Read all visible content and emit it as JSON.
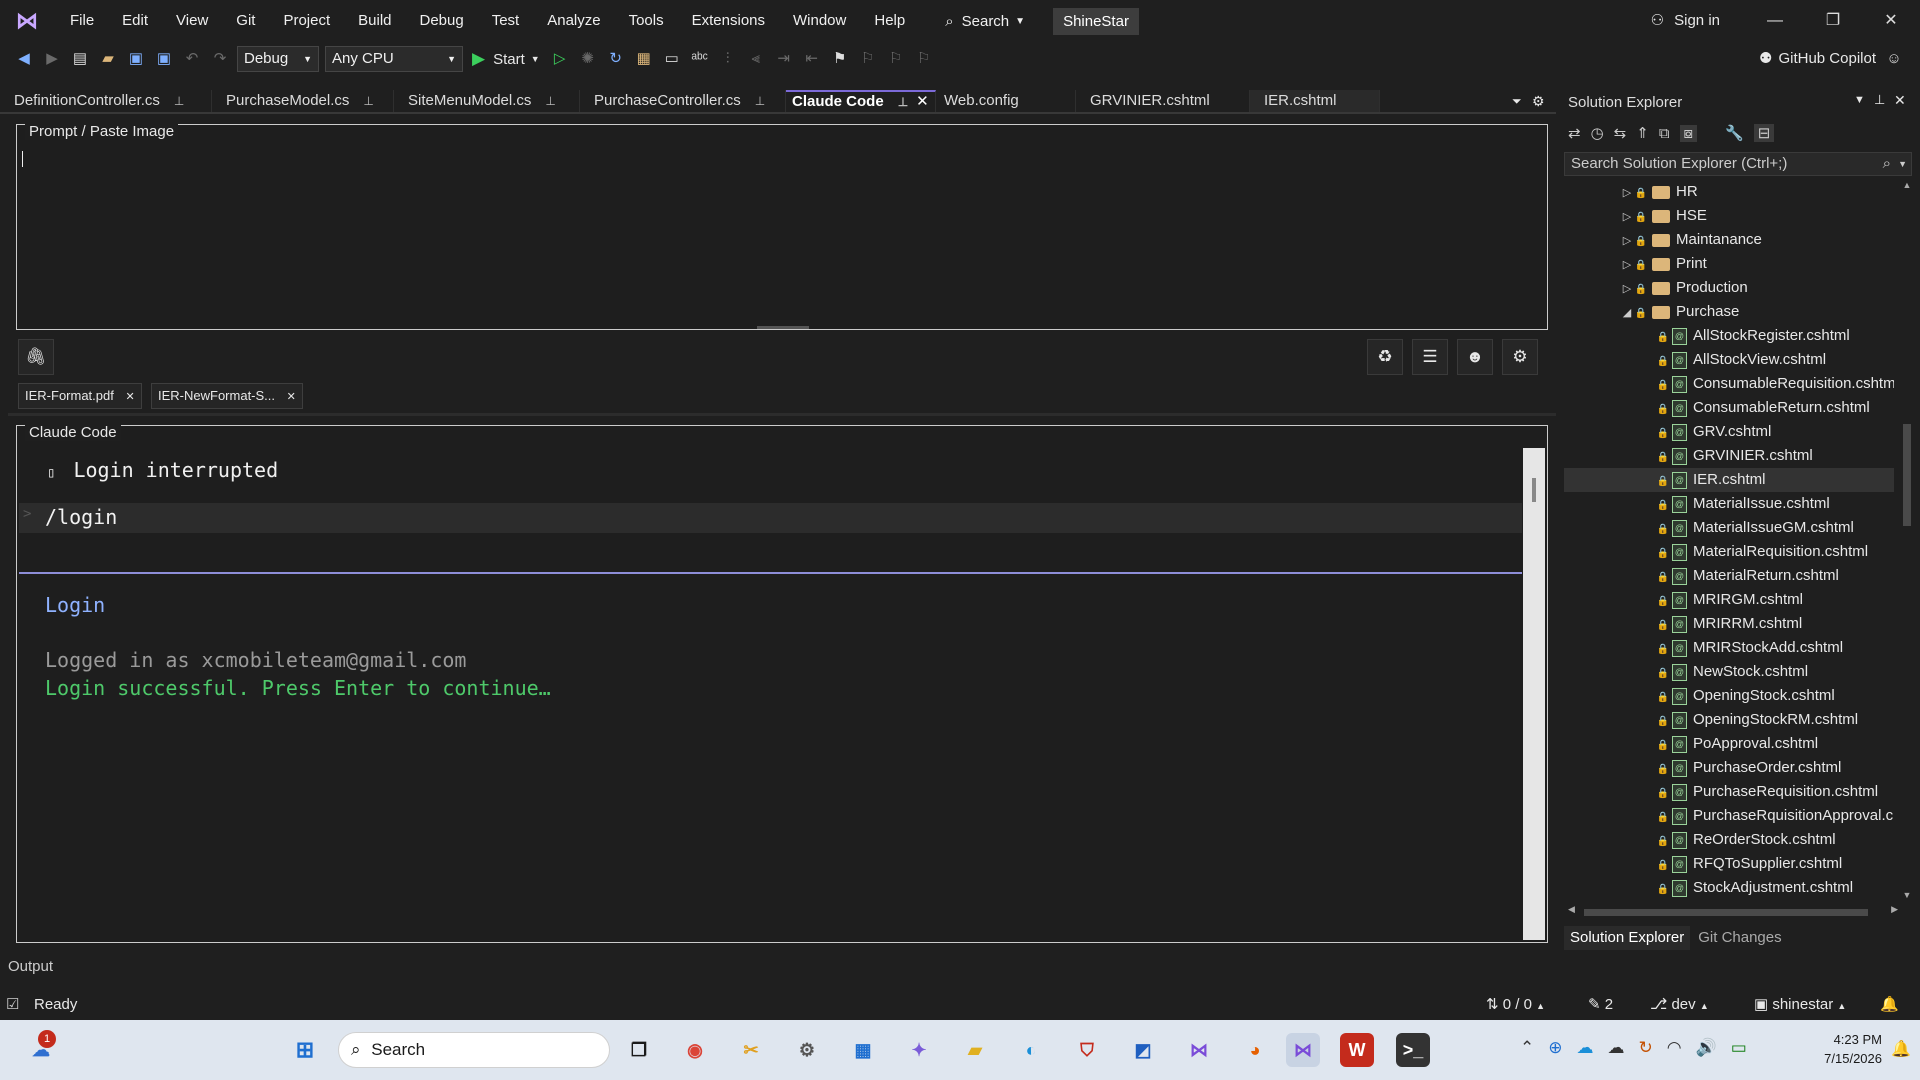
{
  "titlebar": {
    "menu": [
      "File",
      "Edit",
      "View",
      "Git",
      "Project",
      "Build",
      "Debug",
      "Test",
      "Analyze",
      "Tools",
      "Extensions",
      "Window",
      "Help"
    ],
    "search_label": "Search",
    "project_name": "ShineStar",
    "sign_in": "Sign in"
  },
  "toolbar": {
    "config": "Debug",
    "platform": "Any CPU",
    "start_label": "Start",
    "copilot_label": "GitHub Copilot"
  },
  "tabs": [
    {
      "label": "DefinitionController.cs"
    },
    {
      "label": "PurchaseModel.cs"
    },
    {
      "label": "SiteMenuModel.cs"
    },
    {
      "label": "PurchaseController.cs"
    },
    {
      "label": "Claude Code"
    },
    {
      "label": "Web.config"
    },
    {
      "label": "GRVINIER.cshtml"
    },
    {
      "label": "IER.cshtml"
    }
  ],
  "prompt": {
    "legend": "Prompt / Paste Image",
    "attachments": [
      "IER-Format.pdf",
      "IER-NewFormat-S..."
    ]
  },
  "claude_panel": {
    "legend": "Claude Code",
    "interrupt_line": "Login interrupted",
    "command_line": "/login",
    "section_title": "Login",
    "logged_in_text": "Logged in as xcmobileteam@gmail.com",
    "success_text": "Login successful. Press Enter to continue…"
  },
  "solution_explorer": {
    "title": "Solution Explorer",
    "search_placeholder": "Search Solution Explorer (Ctrl+;)",
    "folders": [
      "HR",
      "HSE",
      "Maintanance",
      "Print",
      "Production",
      "Purchase"
    ],
    "files": [
      "AllStockRegister.cshtml",
      "AllStockView.cshtml",
      "ConsumableRequisition.cshtm",
      "ConsumableReturn.cshtml",
      "GRV.cshtml",
      "GRVINIER.cshtml",
      "IER.cshtml",
      "MaterialIssue.cshtml",
      "MaterialIssueGM.cshtml",
      "MaterialRequisition.cshtml",
      "MaterialReturn.cshtml",
      "MRIRGM.cshtml",
      "MRIRRM.cshtml",
      "MRIRStockAdd.cshtml",
      "NewStock.cshtml",
      "OpeningStock.cshtml",
      "OpeningStockRM.cshtml",
      "PoApproval.cshtml",
      "PurchaseOrder.cshtml",
      "PurchaseRequisition.cshtml",
      "PurchaseRquisitionApproval.c",
      "ReOrderStock.cshtml",
      "RFQToSupplier.cshtml",
      "StockAdjustment.cshtml"
    ],
    "bottom_tabs": [
      "Solution Explorer",
      "Git Changes"
    ]
  },
  "output_label": "Output",
  "status": {
    "ready": "Ready",
    "commits": "0 / 0",
    "edits": "2",
    "branch": "dev",
    "repo": "shinestar"
  },
  "taskbar": {
    "search": "Search",
    "time": "4:23 PM",
    "date": "7/15/2026",
    "weather_badge": "1"
  }
}
